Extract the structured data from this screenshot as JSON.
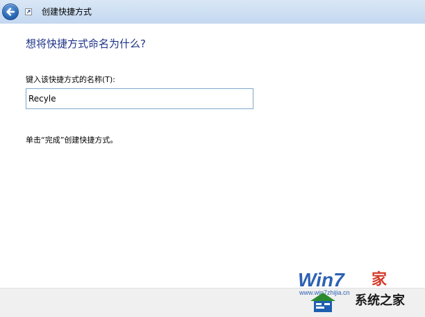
{
  "window": {
    "title": "创建快捷方式"
  },
  "main": {
    "heading": "想将快捷方式命名为什么?",
    "name_label": "键入该快捷方式的名称(T):",
    "name_value": "Recyle",
    "instruction": "单击“完成”创建快捷方式。"
  },
  "watermark": {
    "logo_text": "Win7",
    "home_text": "家",
    "url": "www.win7zhijia.cn",
    "brand": "系统之家"
  },
  "colors": {
    "heading": "#1e3287",
    "titlebar": "#c4d8f0",
    "input_border": "#7ea7cf",
    "bottom_bar": "#f0f0f0"
  },
  "icons": {
    "back": "back-arrow-icon",
    "shortcut": "shortcut-wizard-icon"
  }
}
